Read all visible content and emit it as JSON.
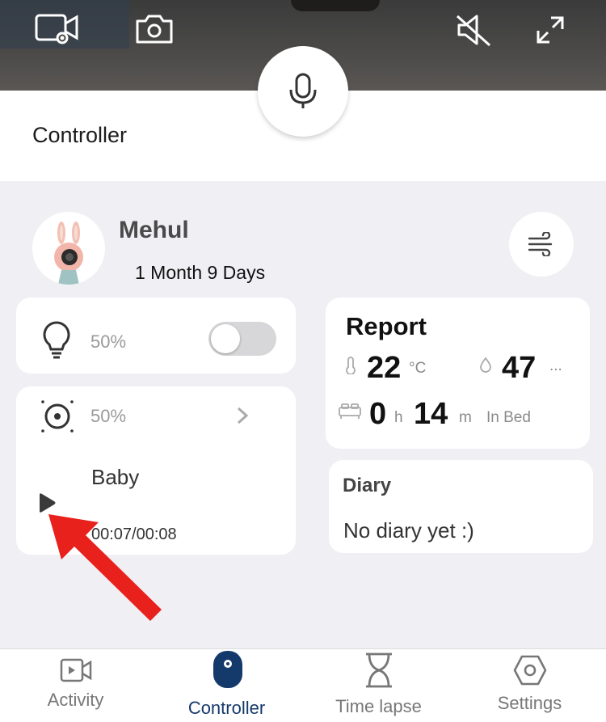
{
  "header": {
    "title": "Controller"
  },
  "video": {
    "icons": [
      "video-record-icon",
      "camera-icon",
      "speaker-muted-icon",
      "fullscreen-icon"
    ],
    "mic_icon": "microphone-icon"
  },
  "profile": {
    "name": "Mehul",
    "age": "1 Month 9 Days",
    "avatar": "bunny-camera-avatar",
    "action_icon": "wind-icon"
  },
  "light": {
    "icon": "bulb-icon",
    "percent": "50%",
    "toggle_on": false
  },
  "sound": {
    "icon": "lullaby-icon",
    "percent": "50%",
    "track": "Baby",
    "time": "00:07/00:08",
    "play_icon": "play-icon"
  },
  "report": {
    "title": "Report",
    "temperature": {
      "value": "22",
      "unit": "°C",
      "icon": "thermometer-icon"
    },
    "humidity": {
      "value": "47",
      "unit": "...",
      "icon": "drop-icon"
    },
    "sleep": {
      "hours": "0",
      "hours_unit": "h",
      "minutes": "14",
      "minutes_unit": "m",
      "label": "In Bed",
      "icon": "bed-icon"
    }
  },
  "diary": {
    "title": "Diary",
    "empty_text": "No diary yet :)"
  },
  "tabs": [
    {
      "label": "Activity",
      "icon": "video-icon",
      "active": false
    },
    {
      "label": "Controller",
      "icon": "controller-icon",
      "active": true
    },
    {
      "label": "Time lapse",
      "icon": "hourglass-icon",
      "active": false
    },
    {
      "label": "Settings",
      "icon": "hexagon-settings-icon",
      "active": false
    }
  ],
  "colors": {
    "accent": "#14396b",
    "annotation_arrow": "#e8211d",
    "background": "#f0eff4"
  }
}
